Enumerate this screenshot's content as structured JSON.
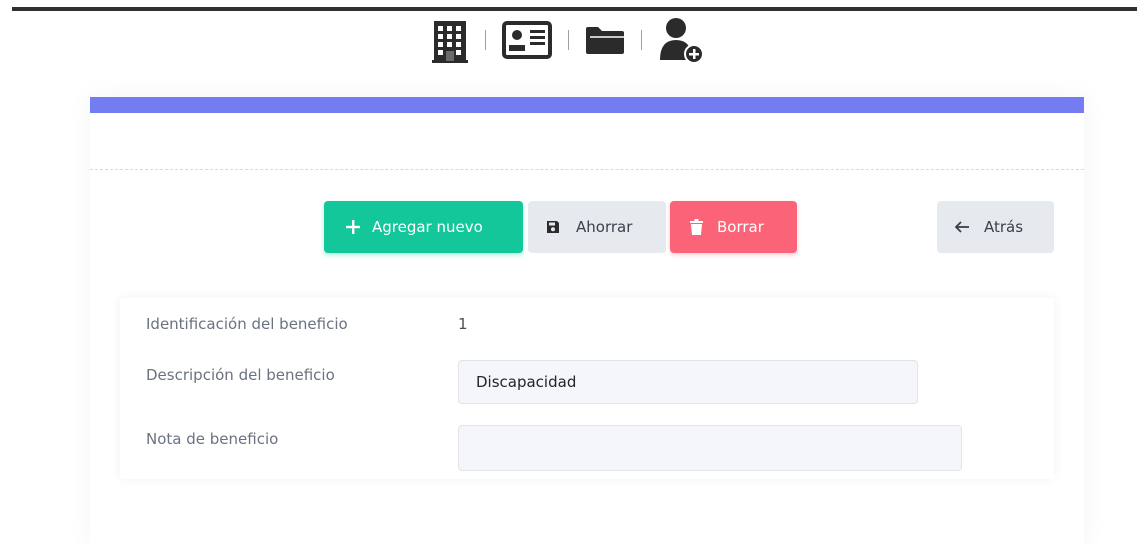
{
  "nav": {
    "icons": [
      "building-icon",
      "id-card-icon",
      "folder-icon",
      "user-plus-icon"
    ]
  },
  "colors": {
    "accent": "#737cf0",
    "add": "#14c79a",
    "delete": "#fb6478",
    "neutral": "#e6e9ee"
  },
  "toolbar": {
    "add_label": "Agregar nuevo",
    "save_label": "Ahorrar",
    "delete_label": "Borrar",
    "back_label": "Atrás"
  },
  "form": {
    "id_label": "Identificación del beneficio",
    "id_value": "1",
    "description_label": "Descripción del beneficio",
    "description_value": "Discapacidad",
    "note_label": "Nota de beneficio",
    "note_value": ""
  }
}
